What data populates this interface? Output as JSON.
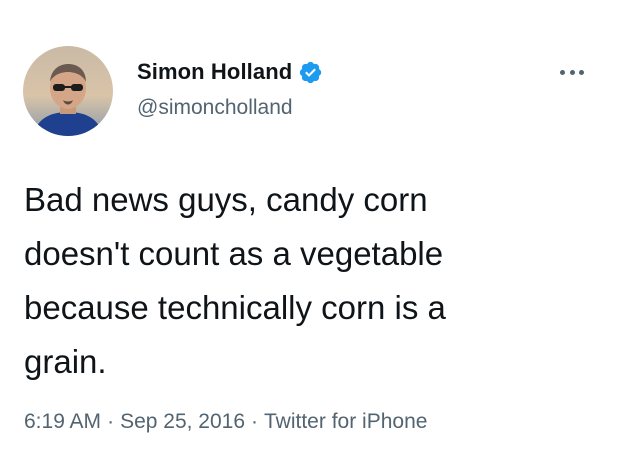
{
  "tweet": {
    "author": {
      "display_name": "Simon Holland",
      "handle": "@simoncholland",
      "verified": true,
      "verified_icon": "verified-badge-icon"
    },
    "more_icon": "more-horizontal-icon",
    "text": "Bad news guys, candy corn\ndoesn't count as a vegetable\nbecause technically corn is a\ngrain.",
    "time": "6:19 AM",
    "date": "Sep 25, 2016",
    "source": "Twitter for iPhone",
    "separator": "·"
  },
  "colors": {
    "text_primary": "#0f1419",
    "text_secondary": "#536471",
    "verified_blue": "#1d9bf0"
  }
}
